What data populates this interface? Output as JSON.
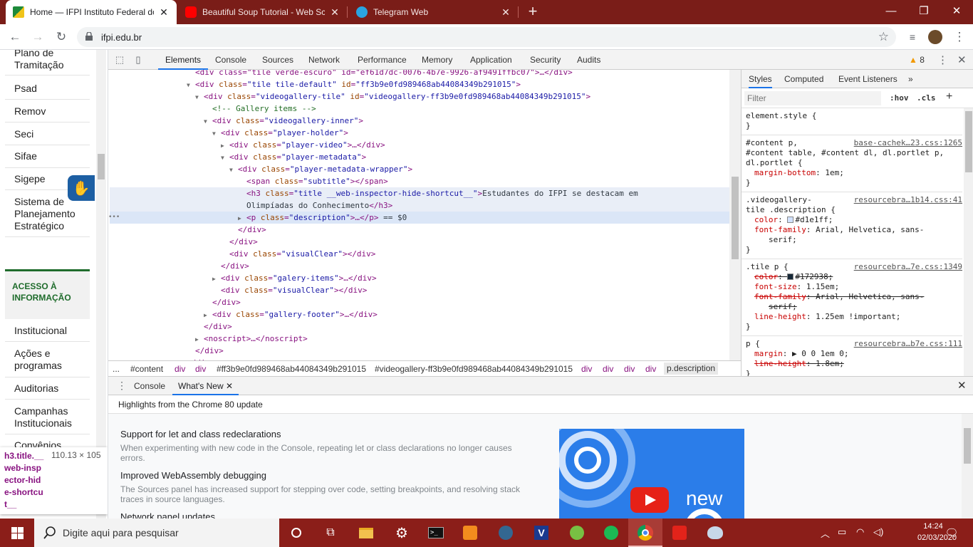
{
  "browser": {
    "tabs": [
      {
        "label": "Home — IFPI Instituto Federal do Piauí",
        "active": true
      },
      {
        "label": "Beautiful Soup Tutorial - Web Scraping",
        "active": false
      },
      {
        "label": "Telegram Web",
        "active": false
      }
    ],
    "url": "ifpi.edu.br"
  },
  "page": {
    "nav_items": [
      "Plano de Tramitação",
      "Psad",
      "Remov",
      "Seci",
      "Sifae",
      "Sigepe",
      "Sistema de Planejamento Estratégico"
    ],
    "access_label": "ACESSO À INFORMAÇÃO",
    "access_items": [
      "Institucional",
      "Ações e programas",
      "Auditorias",
      "Campanhas Institucionais",
      "Convênios"
    ],
    "tooltip": {
      "tag": "h3.title.__web-inspector-hide-shortcut__",
      "size": "110.13 × 105"
    }
  },
  "devtools": {
    "tabs": [
      "Elements",
      "Console",
      "Sources",
      "Network",
      "Performance",
      "Memory",
      "Application",
      "Security",
      "Audits"
    ],
    "warnings": "8",
    "dom": [
      {
        "indent": 9,
        "tri": "",
        "html": [
          [
            "t",
            "<div class=\"tile verde-escuro\" id=\"ef61d7dc-0076-4b7e-9926-af9491ffbc07\">…</div>"
          ]
        ]
      },
      {
        "indent": 9,
        "tri": "▼",
        "html": [
          [
            "t",
            "<div "
          ],
          [
            "an",
            "class"
          ],
          [
            "t",
            "="
          ],
          [
            "av",
            "\"tile tile-default\""
          ],
          [
            "t",
            " "
          ],
          [
            "an",
            "id"
          ],
          [
            "t",
            "="
          ],
          [
            "av",
            "\"ff3b9e0fd989468ab44084349b291015\""
          ],
          [
            "t",
            ">"
          ]
        ]
      },
      {
        "indent": 10,
        "tri": "▼",
        "html": [
          [
            "t",
            "<div "
          ],
          [
            "an",
            "class"
          ],
          [
            "t",
            "="
          ],
          [
            "av",
            "\"videogallery-tile\""
          ],
          [
            "t",
            " "
          ],
          [
            "an",
            "id"
          ],
          [
            "t",
            "="
          ],
          [
            "av",
            "\"videogallery-ff3b9e0fd989468ab44084349b291015\""
          ],
          [
            "t",
            ">"
          ]
        ]
      },
      {
        "indent": 11,
        "tri": "",
        "html": [
          [
            "cm",
            "<!-- Gallery items -->"
          ]
        ]
      },
      {
        "indent": 11,
        "tri": "▼",
        "html": [
          [
            "t",
            "<div "
          ],
          [
            "an",
            "class"
          ],
          [
            "t",
            "="
          ],
          [
            "av",
            "\"videogallery-inner\""
          ],
          [
            "t",
            ">"
          ]
        ]
      },
      {
        "indent": 12,
        "tri": "▼",
        "html": [
          [
            "t",
            "<div "
          ],
          [
            "an",
            "class"
          ],
          [
            "t",
            "="
          ],
          [
            "av",
            "\"player-holder\""
          ],
          [
            "t",
            ">"
          ]
        ]
      },
      {
        "indent": 13,
        "tri": "▶",
        "html": [
          [
            "t",
            "<div "
          ],
          [
            "an",
            "class"
          ],
          [
            "t",
            "="
          ],
          [
            "av",
            "\"player-video\""
          ],
          [
            "t",
            ">…</div>"
          ]
        ]
      },
      {
        "indent": 13,
        "tri": "▼",
        "html": [
          [
            "t",
            "<div "
          ],
          [
            "an",
            "class"
          ],
          [
            "t",
            "="
          ],
          [
            "av",
            "\"player-metadata\""
          ],
          [
            "t",
            ">"
          ]
        ]
      },
      {
        "indent": 14,
        "tri": "▼",
        "html": [
          [
            "t",
            "<div "
          ],
          [
            "an",
            "class"
          ],
          [
            "t",
            "="
          ],
          [
            "av",
            "\"player-metadata-wrapper\""
          ],
          [
            "t",
            ">"
          ]
        ]
      },
      {
        "indent": 15,
        "tri": "",
        "html": [
          [
            "t",
            "<span "
          ],
          [
            "an",
            "class"
          ],
          [
            "t",
            "="
          ],
          [
            "av",
            "\"subtitle\""
          ],
          [
            "t",
            "></span>"
          ]
        ]
      },
      {
        "indent": 15,
        "tri": "",
        "hl": true,
        "html": [
          [
            "t",
            "<h3 "
          ],
          [
            "an",
            "class"
          ],
          [
            "t",
            "="
          ],
          [
            "av",
            "\"title __web-inspector-hide-shortcut__\""
          ],
          [
            "t",
            ">"
          ],
          [
            "tx",
            "Estudantes do IFPI se destacam em"
          ]
        ]
      },
      {
        "indent": 15,
        "tri": "",
        "hl": true,
        "html": [
          [
            "tx",
            "Olimpíadas do Conhecimento"
          ],
          [
            "t",
            "</h3>"
          ]
        ]
      },
      {
        "indent": 15,
        "tri": "▶",
        "sel": true,
        "html": [
          [
            "t",
            "<p "
          ],
          [
            "an",
            "class"
          ],
          [
            "t",
            "="
          ],
          [
            "av",
            "\"description\""
          ],
          [
            "t",
            ">…</p>"
          ],
          [
            "tx",
            " == $0"
          ]
        ]
      },
      {
        "indent": 14,
        "tri": "",
        "html": [
          [
            "t",
            "</div>"
          ]
        ]
      },
      {
        "indent": 13,
        "tri": "",
        "html": [
          [
            "t",
            "</div>"
          ]
        ]
      },
      {
        "indent": 13,
        "tri": "",
        "html": [
          [
            "t",
            "<div "
          ],
          [
            "an",
            "class"
          ],
          [
            "t",
            "="
          ],
          [
            "av",
            "\"visualClear\""
          ],
          [
            "t",
            "></div>"
          ]
        ]
      },
      {
        "indent": 12,
        "tri": "",
        "html": [
          [
            "t",
            "</div>"
          ]
        ]
      },
      {
        "indent": 12,
        "tri": "▶",
        "html": [
          [
            "t",
            "<div "
          ],
          [
            "an",
            "class"
          ],
          [
            "t",
            "="
          ],
          [
            "av",
            "\"galery-items\""
          ],
          [
            "t",
            ">…</div>"
          ]
        ]
      },
      {
        "indent": 12,
        "tri": "",
        "html": [
          [
            "t",
            "<div "
          ],
          [
            "an",
            "class"
          ],
          [
            "t",
            "="
          ],
          [
            "av",
            "\"visualClear\""
          ],
          [
            "t",
            "></div>"
          ]
        ]
      },
      {
        "indent": 11,
        "tri": "",
        "html": [
          [
            "t",
            "</div>"
          ]
        ]
      },
      {
        "indent": 11,
        "tri": "▶",
        "html": [
          [
            "t",
            "<div "
          ],
          [
            "an",
            "class"
          ],
          [
            "t",
            "="
          ],
          [
            "av",
            "\"gallery-footer\""
          ],
          [
            "t",
            ">…</div>"
          ]
        ]
      },
      {
        "indent": 10,
        "tri": "",
        "html": [
          [
            "t",
            "</div>"
          ]
        ]
      },
      {
        "indent": 10,
        "tri": "▶",
        "html": [
          [
            "t",
            "<noscript>…</noscript>"
          ]
        ]
      },
      {
        "indent": 9,
        "tri": "",
        "html": [
          [
            "t",
            "</div>"
          ]
        ]
      },
      {
        "indent": 8,
        "tri": "",
        "html": [
          [
            "t",
            "</div>"
          ]
        ]
      }
    ],
    "breadcrumbs": [
      "...",
      "#content",
      "div",
      "div",
      "#ff3b9e0fd989468ab44084349b291015",
      "#videogallery-ff3b9e0fd989468ab44084349b291015",
      "div",
      "div",
      "div",
      "div",
      "p.description"
    ],
    "styles": {
      "tabs": [
        "Styles",
        "Computed",
        "Event Listeners"
      ],
      "filter_placeholder": "Filter",
      "hov": ":hov",
      "cls": ".cls",
      "rules": [
        {
          "lines": [
            [
              "element.style {"
            ],
            [
              "}"
            ]
          ],
          "src": ""
        },
        {
          "lines": [
            [
              "#content p,"
            ],
            [
              "#content table, #content dl, dl.portlet p,"
            ],
            [
              "dl.portlet {"
            ],
            [
              "  margin-bottom: 1em;"
            ],
            [
              "}"
            ]
          ],
          "src": "base-cachek…23.css:1265"
        },
        {
          "lines": [
            [
              ".videogallery-"
            ],
            [
              "tile .description {"
            ],
            [
              "  color: #d1e1ff;"
            ],
            [
              "  font-family: Arial, Helvetica, sans-"
            ],
            [
              "      serif;"
            ],
            [
              "}"
            ]
          ],
          "src": "resourcebra…1b14.css:41"
        },
        {
          "lines": [
            [
              ".tile p {"
            ],
            [
              "  color: #172938;"
            ],
            [
              "  font-size: 1.15em;"
            ],
            [
              "  font-family: Arial, Helvetica, sans-"
            ],
            [
              "      serif;"
            ],
            [
              "  line-height: 1.25em !important;"
            ],
            [
              "}"
            ]
          ],
          "src": "resourcebra…7e.css:1349"
        },
        {
          "lines": [
            [
              "p {"
            ],
            [
              "  margin: ▶ 0 0 1em 0;"
            ],
            [
              "  line-height: 1.8em;"
            ],
            [
              "}"
            ]
          ],
          "src": "resourcebra…b7e.css:111"
        }
      ],
      "colors": {
        "swatch1": "#d1e1ff",
        "swatch2": "#172938"
      }
    },
    "drawer": {
      "tabs": [
        "Console",
        "What's New"
      ],
      "highlight": "Highlights from the Chrome 80 update",
      "items": [
        {
          "title": "Support for let and class redeclarations",
          "body": "When experimenting with new code in the Console, repeating let or class declarations no longer causes errors."
        },
        {
          "title": "Improved WebAssembly debugging",
          "body": "The Sources panel has increased support for stepping over code, setting breakpoints, and resolving stack traces in source languages."
        },
        {
          "title": "Network panel updates",
          "body": ""
        }
      ],
      "video_label": "new"
    }
  },
  "taskbar": {
    "search_placeholder": "Digite aqui para pesquisar",
    "time": "14:24",
    "date": "02/03/2020"
  },
  "theme": {
    "titlebar": "#7a1d18",
    "taskbar": "#8b1e19",
    "accent": "#1a73e8",
    "ifpi_green": "#1f6c2c"
  }
}
